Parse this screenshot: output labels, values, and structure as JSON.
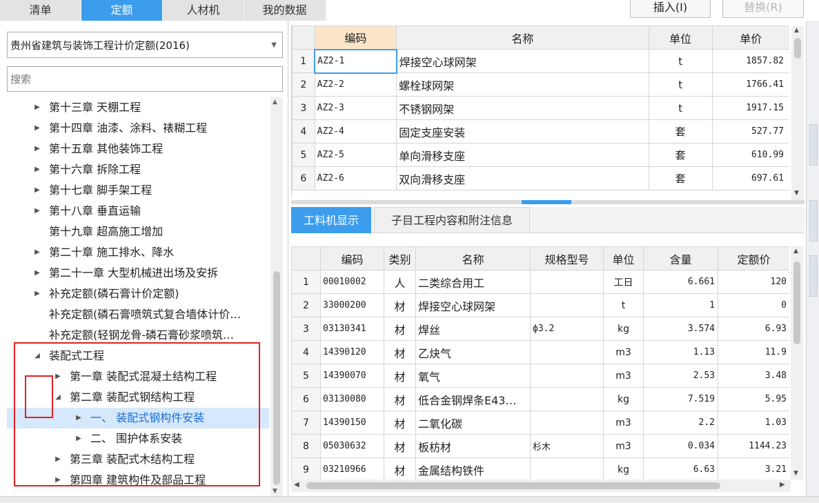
{
  "tabs": [
    "清单",
    "定额",
    "人材机",
    "我的数据"
  ],
  "active_tab": 1,
  "buttons": {
    "insert": "插入(I)",
    "replace": "替换(R)"
  },
  "quota_library": "贵州省建筑与装饰工程计价定额(2016)",
  "search": {
    "placeholder": "搜索"
  },
  "tree": [
    {
      "label": "第十三章 天棚工程",
      "level": 0,
      "toggle": "collapsed"
    },
    {
      "label": "第十四章 油漆、涂料、裱糊工程",
      "level": 0,
      "toggle": "collapsed"
    },
    {
      "label": "第十五章 其他装饰工程",
      "level": 0,
      "toggle": "collapsed"
    },
    {
      "label": "第十六章 拆除工程",
      "level": 0,
      "toggle": "collapsed"
    },
    {
      "label": "第十七章 脚手架工程",
      "level": 0,
      "toggle": "collapsed"
    },
    {
      "label": "第十八章 垂直运输",
      "level": 0,
      "toggle": "collapsed"
    },
    {
      "label": "第十九章 超高施工增加",
      "level": 0,
      "toggle": "none"
    },
    {
      "label": "第二十章 施工排水、降水",
      "level": 0,
      "toggle": "collapsed"
    },
    {
      "label": "第二十一章 大型机械进出场及安拆",
      "level": 0,
      "toggle": "collapsed"
    },
    {
      "label": "补充定额(磷石膏计价定额)",
      "level": 0,
      "toggle": "collapsed"
    },
    {
      "label": "补充定额(磷石膏喷筑式复合墙体计价…",
      "level": 0,
      "toggle": "none"
    },
    {
      "label": "补充定额(轻钢龙骨-磷石膏砂浆喷筑…",
      "level": 0,
      "toggle": "none"
    },
    {
      "label": "装配式工程",
      "level": 0,
      "toggle": "expanded"
    },
    {
      "label": "第一章 装配式混凝土结构工程",
      "level": 1,
      "toggle": "collapsed"
    },
    {
      "label": "第二章 装配式钢结构工程",
      "level": 1,
      "toggle": "expanded"
    },
    {
      "label": "一、 装配式钢构件安装",
      "level": 2,
      "toggle": "collapsed",
      "selected": true
    },
    {
      "label": "二、 围护体系安装",
      "level": 2,
      "toggle": "collapsed"
    },
    {
      "label": "第三章 装配式木结构工程",
      "level": 1,
      "toggle": "collapsed"
    },
    {
      "label": "第四章 建筑构件及部品工程",
      "level": 1,
      "toggle": "collapsed"
    }
  ],
  "quota_grid": {
    "headers": [
      "",
      "编码",
      "名称",
      "单位",
      "单价"
    ],
    "rows": [
      {
        "no": "1",
        "code": "AZ2-1",
        "name": "焊接空心球网架",
        "unit": "t",
        "price": "1857.82"
      },
      {
        "no": "2",
        "code": "AZ2-2",
        "name": "螺栓球网架",
        "unit": "t",
        "price": "1766.41"
      },
      {
        "no": "3",
        "code": "AZ2-3",
        "name": "不锈钢网架",
        "unit": "t",
        "price": "1917.15"
      },
      {
        "no": "4",
        "code": "AZ2-4",
        "name": "固定支座安装",
        "unit": "套",
        "price": "527.77"
      },
      {
        "no": "5",
        "code": "AZ2-5",
        "name": "单向滑移支座",
        "unit": "套",
        "price": "610.99"
      },
      {
        "no": "6",
        "code": "AZ2-6",
        "name": "双向滑移支座",
        "unit": "套",
        "price": "697.61"
      }
    ]
  },
  "lower_tabs": [
    "工料机显示",
    "子目工程内容和附注信息"
  ],
  "resource_grid": {
    "headers": [
      "",
      "编码",
      "类别",
      "名称",
      "规格型号",
      "单位",
      "含量",
      "定额价"
    ],
    "rows": [
      {
        "no": "1",
        "code": "00010002",
        "cat": "人",
        "name": "二类综合用工",
        "spec": "",
        "unit": "工日",
        "qty": "6.661",
        "price": "120"
      },
      {
        "no": "2",
        "code": "33000200",
        "cat": "材",
        "name": "焊接空心球网架",
        "spec": "",
        "unit": "t",
        "qty": "1",
        "price": "0"
      },
      {
        "no": "3",
        "code": "03130341",
        "cat": "材",
        "name": "焊丝",
        "spec": "ф3.2",
        "unit": "kg",
        "qty": "3.574",
        "price": "6.93"
      },
      {
        "no": "4",
        "code": "14390120",
        "cat": "材",
        "name": "乙炔气",
        "spec": "",
        "unit": "m3",
        "qty": "1.13",
        "price": "11.9"
      },
      {
        "no": "5",
        "code": "14390070",
        "cat": "材",
        "name": "氧气",
        "spec": "",
        "unit": "m3",
        "qty": "2.53",
        "price": "3.48"
      },
      {
        "no": "6",
        "code": "03130080",
        "cat": "材",
        "name": "低合金钢焊条E43…",
        "spec": "",
        "unit": "kg",
        "qty": "7.519",
        "price": "5.95"
      },
      {
        "no": "7",
        "code": "14390150",
        "cat": "材",
        "name": "二氧化碳",
        "spec": "",
        "unit": "m3",
        "qty": "2.2",
        "price": "1.03"
      },
      {
        "no": "8",
        "code": "05030632",
        "cat": "材",
        "name": "板枋材",
        "spec": "杉木",
        "unit": "m3",
        "qty": "0.034",
        "price": "1144.23"
      },
      {
        "no": "9",
        "code": "03210966",
        "cat": "材",
        "name": "金属结构铁件",
        "spec": "",
        "unit": "kg",
        "qty": "6.63",
        "price": "3.21"
      }
    ]
  }
}
